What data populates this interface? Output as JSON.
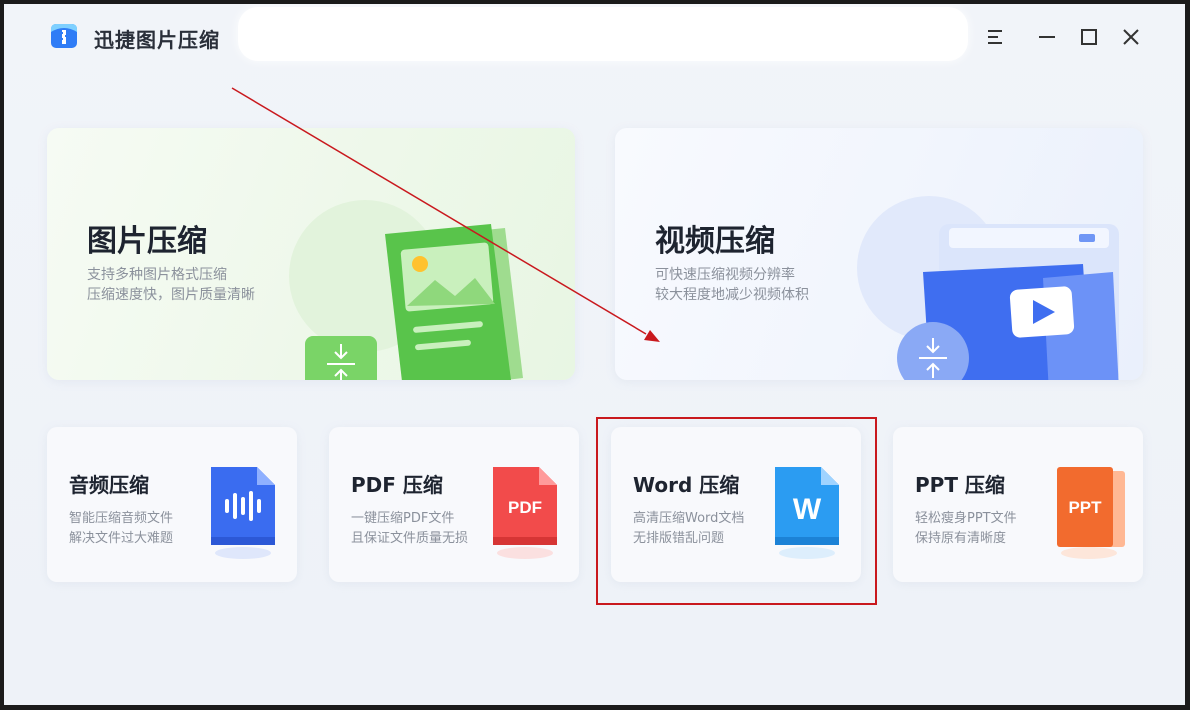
{
  "app": {
    "title": "迅捷图片压缩"
  },
  "window_controls": {
    "menu": "menu-icon",
    "minimize": "minimize-icon",
    "maximize": "maximize-icon",
    "close": "close-icon"
  },
  "big_cards": [
    {
      "title": "图片压缩",
      "desc_line1": "支持多种图片格式压缩",
      "desc_line2": "压缩速度快，图片质量清晰",
      "accent": "#4cc04f"
    },
    {
      "title": "视频压缩",
      "desc_line1": "可快速压缩视频分辨率",
      "desc_line2": "较大程度地减少视频体积",
      "accent": "#3b6ef0"
    }
  ],
  "small_cards": [
    {
      "title": "音频压缩",
      "desc_line1": "智能压缩音频文件",
      "desc_line2": "解决文件过大难题",
      "icon": "audio-file-icon",
      "accent": "#3a6cf0"
    },
    {
      "title": "PDF 压缩",
      "desc_line1": "一键压缩PDF文件",
      "desc_line2": "且保证文件质量无损",
      "icon_text": "PDF",
      "accent": "#f24b4b"
    },
    {
      "title": "Word 压缩",
      "desc_line1": "高清压缩Word文档",
      "desc_line2": "无排版错乱问题",
      "icon_text": "W",
      "accent": "#2b9cf2"
    },
    {
      "title": "PPT 压缩",
      "desc_line1": "轻松瘦身PPT文件",
      "desc_line2": "保持原有清晰度",
      "icon_text": "PPT",
      "accent": "#f26b2e"
    }
  ],
  "annotation": {
    "highlight_color": "#c9191e"
  }
}
